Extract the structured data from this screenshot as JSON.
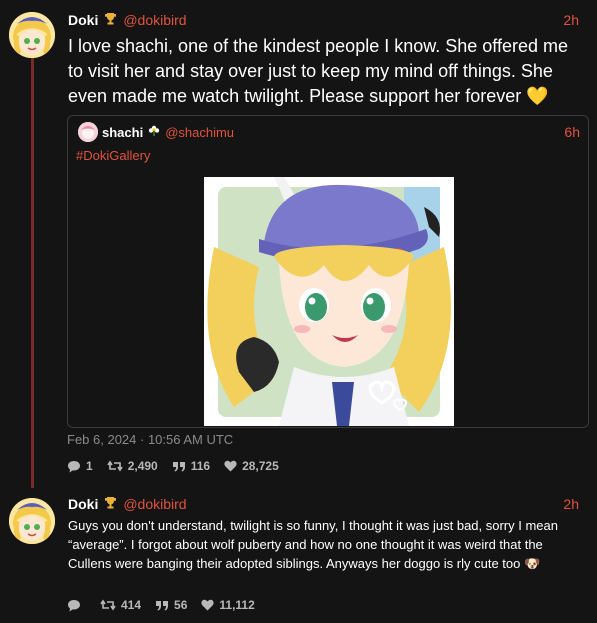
{
  "post1": {
    "name": "Doki",
    "handle": "@dokibird",
    "time": "2h",
    "text": "I love shachi, one of the kindest people I know. She offered me to visit her and stay over just to keep my mind off things. She even made me watch twilight. Please support her forever",
    "emoji": "💛",
    "quote": {
      "name": "shachi",
      "handle": "@shachimu",
      "time": "6h",
      "hashtag": "#DokiGallery"
    },
    "date": "Feb 6, 2024 · 10:56 AM UTC",
    "stats": {
      "replies": "1",
      "retweets": "2,490",
      "quotes": "116",
      "likes": "28,725"
    }
  },
  "post2": {
    "name": "Doki",
    "handle": "@dokibird",
    "time": "2h",
    "text": "Guys you don't understand, twilight is so funny, I thought it was just bad, sorry I mean “average”. I forgot about wolf puberty and how no one thought it was weird that the Cullens were banging their adopted siblings. Anyways her doggo is rly cute too",
    "emoji": "🐶",
    "stats": {
      "replies": "",
      "retweets": "414",
      "quotes": "56",
      "likes": "11,112"
    }
  },
  "colors": {
    "background": "#141414",
    "accent": "#e0533d",
    "thread_line": "#7a2a2a",
    "muted": "#8a8a8a"
  },
  "icons": [
    "trophy-icon",
    "flower-icon",
    "reply-icon",
    "retweet-icon",
    "quote-icon",
    "heart-icon",
    "yellow-heart-emoji",
    "dog-emoji"
  ]
}
